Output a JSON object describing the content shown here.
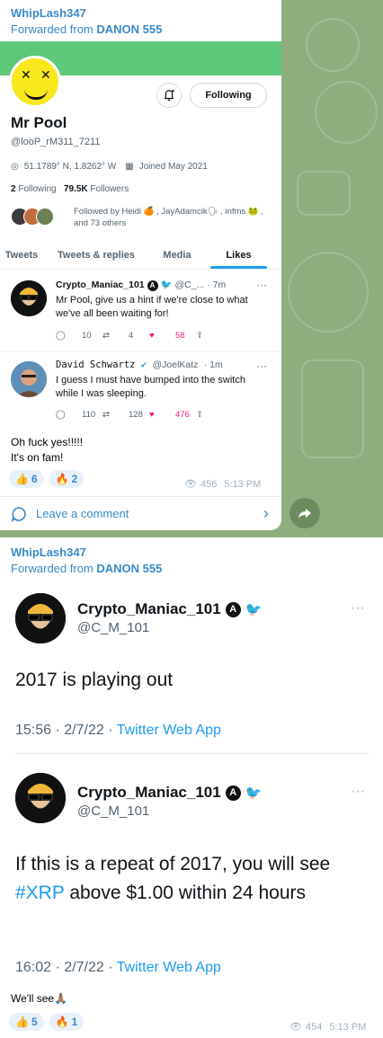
{
  "message1": {
    "sender": "WhipLash347",
    "forwarded_prefix": "Forwarded from",
    "forwarded_source": "DANON 555",
    "profile": {
      "follow_label": "Following",
      "name": "Mr Pool",
      "handle": "@looP_rM311_7211",
      "location": "51.1789° N, 1.8262° W",
      "joined": "Joined May 2021",
      "following_count": "2",
      "following_label": "Following",
      "followers_count": "79.5K",
      "followers_label": "Followers",
      "followed_by": "Followed by Heidi 🍊 , JayAdamcik🗣 , infms 🐸 , and 73 others"
    },
    "tabs": [
      "Tweets",
      "Tweets & replies",
      "Media",
      "Likes"
    ],
    "tweets": [
      {
        "name": "Crypto_Maniac_101",
        "handle": "@C_...",
        "time": "· 7m",
        "text": "Mr Pool, give us a hint if we're close to what we've all been waiting for!",
        "replies": "10",
        "retweets": "4",
        "likes": "58"
      },
      {
        "name": "David Schwartz",
        "handle": "@JoelKatz",
        "time": "· 1m",
        "text": "I guess I must have bumped into the switch while I was sleeping.",
        "replies": "110",
        "retweets": "128",
        "likes": "476"
      }
    ],
    "caption_line1": "Oh fuck yes!!!!!",
    "caption_line2": "It's on fam!",
    "reactions": [
      {
        "emoji": "👍",
        "count": "6"
      },
      {
        "emoji": "🔥",
        "count": "2"
      }
    ],
    "views": "456",
    "time": "5:13 PM",
    "comment_label": "Leave a comment"
  },
  "message2": {
    "sender": "WhipLash347",
    "forwarded_prefix": "Forwarded from",
    "forwarded_source": "DANON 555",
    "tweets": [
      {
        "name": "Crypto_Maniac_101",
        "handle": "@C_M_101",
        "text": "2017 is playing out",
        "time": "15:56 · 2/7/22 ·",
        "app": "Twitter Web App"
      },
      {
        "name": "Crypto_Maniac_101",
        "handle": "@C_M_101",
        "text_pre": "If this is a repeat of 2017, you will see ",
        "text_tag": "#XRP",
        "text_post": " above $1.00 within 24 hours",
        "time": "16:02 · 2/7/22 ·",
        "app": "Twitter Web App"
      }
    ],
    "caption": "We'll see🙏🏽",
    "reactions": [
      {
        "emoji": "👍",
        "count": "5"
      },
      {
        "emoji": "🔥",
        "count": "1"
      }
    ],
    "views": "454",
    "time": "5:13 PM"
  },
  "colors": {
    "chat_bg": "#8fae7e",
    "telegram_blue": "#3a89c9",
    "twitter_blue": "#1d9bf0",
    "like_pink": "#f91880",
    "banner_green": "#5ec879"
  }
}
